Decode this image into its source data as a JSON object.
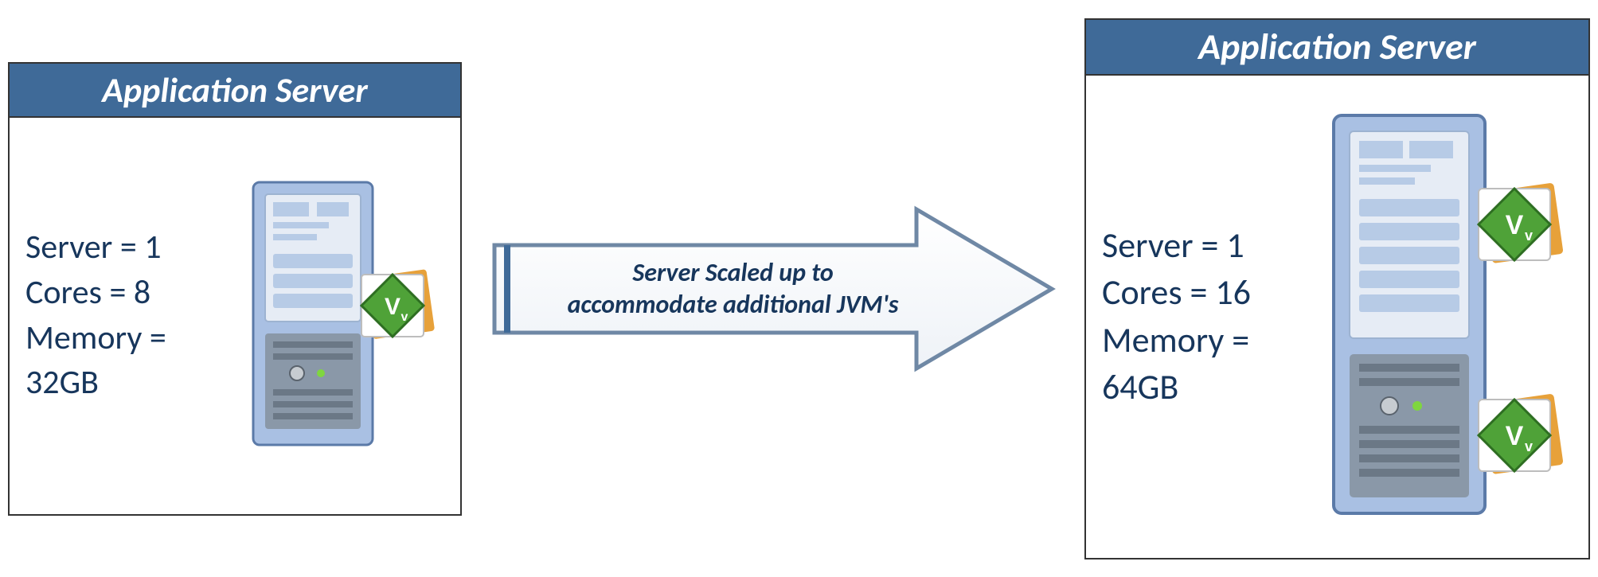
{
  "colors": {
    "headerBg": "#3f6a98",
    "headerText": "#ffffff",
    "bodyText": "#17365c",
    "boxBorder": "#333333"
  },
  "leftBox": {
    "title": "Application Server",
    "specs": "Server = 1\nCores = 8\nMemory = 32GB",
    "server": 1,
    "cores": 8,
    "memory": "32GB",
    "jvmCount": 1
  },
  "arrow": {
    "label": "Server Scaled up to accommodate additional JVM's"
  },
  "rightBox": {
    "title": "Application Server",
    "specs": "Server = 1\nCores = 16\nMemory = 64GB",
    "server": 1,
    "cores": 16,
    "memory": "64GB",
    "jvmCount": 2
  },
  "icons": {
    "server": "server-tower-icon",
    "jvm": "vault-jvm-badge-icon"
  }
}
